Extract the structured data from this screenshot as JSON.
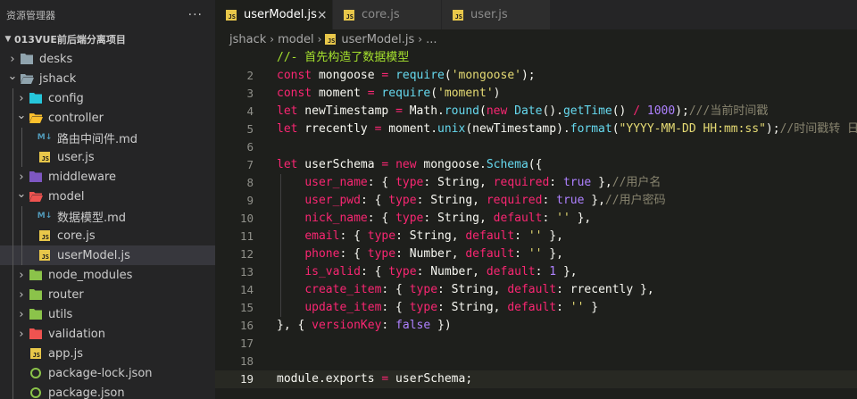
{
  "sidebar": {
    "title": "资源管理器",
    "more_glyph": "···",
    "section_title": "013VUE前后端分离项目",
    "tree": [
      {
        "label": "desks",
        "type": "folder",
        "open": false,
        "depth": 0,
        "icon_color": "#90a4ae"
      },
      {
        "label": "jshack",
        "type": "folder",
        "open": true,
        "depth": 0,
        "icon_color": "#90a4ae"
      },
      {
        "label": "config",
        "type": "folder",
        "open": false,
        "depth": 1,
        "icon_color": "#26c6da"
      },
      {
        "label": "controller",
        "type": "folder",
        "open": true,
        "depth": 1,
        "icon_color": "#fbc02d"
      },
      {
        "label": "路由中间件.md",
        "type": "md",
        "depth": 2
      },
      {
        "label": "user.js",
        "type": "js",
        "depth": 2
      },
      {
        "label": "middleware",
        "type": "folder",
        "open": false,
        "depth": 1,
        "icon_color": "#7e57c2"
      },
      {
        "label": "model",
        "type": "folder",
        "open": true,
        "depth": 1,
        "icon_color": "#ef5350"
      },
      {
        "label": "数据模型.md",
        "type": "md",
        "depth": 2
      },
      {
        "label": "core.js",
        "type": "js",
        "depth": 2
      },
      {
        "label": "userModel.js",
        "type": "js",
        "depth": 2,
        "selected": true
      },
      {
        "label": "node_modules",
        "type": "folder",
        "open": false,
        "depth": 1,
        "icon_color": "#8bc34a"
      },
      {
        "label": "router",
        "type": "folder",
        "open": false,
        "depth": 1,
        "icon_color": "#8bc34a"
      },
      {
        "label": "utils",
        "type": "folder",
        "open": false,
        "depth": 1,
        "icon_color": "#8bc34a"
      },
      {
        "label": "validation",
        "type": "folder",
        "open": false,
        "depth": 1,
        "icon_color": "#ef5350"
      },
      {
        "label": "app.js",
        "type": "js",
        "depth": 1
      },
      {
        "label": "package-lock.json",
        "type": "json",
        "depth": 1
      },
      {
        "label": "package.json",
        "type": "json",
        "depth": 1
      }
    ]
  },
  "tabs": [
    {
      "label": "userModel.js",
      "active": true,
      "close": "×"
    },
    {
      "label": "core.js",
      "active": false,
      "close": ""
    },
    {
      "label": "user.js",
      "active": false,
      "close": ""
    }
  ],
  "breadcrumb": {
    "parts": [
      "jshack",
      "model"
    ],
    "file": "userModel.js",
    "ellipsis": "..."
  },
  "editor": {
    "current_line": 19,
    "lines": [
      {
        "n": "",
        "tokens": [
          [
            "t-com",
            "//- 首先构造了数据模型"
          ]
        ]
      },
      {
        "n": "2",
        "tokens": [
          [
            "t-kw",
            "const"
          ],
          [
            "t-plain",
            " mongoose "
          ],
          [
            "t-kw",
            "="
          ],
          [
            "t-plain",
            " "
          ],
          [
            "t-fn",
            "require"
          ],
          [
            "t-plain",
            "("
          ],
          [
            "t-str",
            "'mongoose'"
          ],
          [
            "t-plain",
            ");"
          ]
        ]
      },
      {
        "n": "3",
        "tokens": [
          [
            "t-kw",
            "const"
          ],
          [
            "t-plain",
            " moment "
          ],
          [
            "t-kw",
            "="
          ],
          [
            "t-plain",
            " "
          ],
          [
            "t-fn",
            "require"
          ],
          [
            "t-plain",
            "("
          ],
          [
            "t-str",
            "'moment'"
          ],
          [
            "t-plain",
            ")"
          ]
        ]
      },
      {
        "n": "4",
        "tokens": [
          [
            "t-kw",
            "let"
          ],
          [
            "t-plain",
            " newTimestamp "
          ],
          [
            "t-kw",
            "="
          ],
          [
            "t-plain",
            " Math."
          ],
          [
            "t-fn",
            "round"
          ],
          [
            "t-plain",
            "("
          ],
          [
            "t-kw",
            "new"
          ],
          [
            "t-plain",
            " "
          ],
          [
            "t-fn",
            "Date"
          ],
          [
            "t-plain",
            "()."
          ],
          [
            "t-fn",
            "getTime"
          ],
          [
            "t-plain",
            "() "
          ],
          [
            "t-kw",
            "/"
          ],
          [
            "t-plain",
            " "
          ],
          [
            "t-num",
            "1000"
          ],
          [
            "t-plain",
            ");"
          ],
          [
            "t-gcom",
            "///当前时间戳"
          ]
        ]
      },
      {
        "n": "5",
        "tokens": [
          [
            "t-kw",
            "let"
          ],
          [
            "t-plain",
            " rrecently "
          ],
          [
            "t-kw",
            "="
          ],
          [
            "t-plain",
            " moment."
          ],
          [
            "t-fn",
            "unix"
          ],
          [
            "t-plain",
            "(newTimestamp)."
          ],
          [
            "t-fn",
            "format"
          ],
          [
            "t-plain",
            "("
          ],
          [
            "t-str",
            "\"YYYY-MM-DD HH:mm:ss\""
          ],
          [
            "t-plain",
            ");"
          ],
          [
            "t-gcom",
            "//时间戳转 日"
          ]
        ]
      },
      {
        "n": "6",
        "tokens": []
      },
      {
        "n": "7",
        "tokens": [
          [
            "t-kw",
            "let"
          ],
          [
            "t-plain",
            " userSchema "
          ],
          [
            "t-kw",
            "="
          ],
          [
            "t-plain",
            " "
          ],
          [
            "t-kw",
            "new"
          ],
          [
            "t-plain",
            " mongoose."
          ],
          [
            "t-fn",
            "Schema"
          ],
          [
            "t-plain",
            "({"
          ]
        ]
      },
      {
        "n": "8",
        "tokens": [
          [
            "t-plain",
            "    "
          ],
          [
            "t-kw",
            "user_name"
          ],
          [
            "t-plain",
            ": { "
          ],
          [
            "t-kw",
            "type"
          ],
          [
            "t-plain",
            ": String, "
          ],
          [
            "t-kw",
            "required"
          ],
          [
            "t-plain",
            ": "
          ],
          [
            "t-bool",
            "true"
          ],
          [
            "t-plain",
            " },"
          ],
          [
            "t-gcom",
            "//用户名"
          ]
        ]
      },
      {
        "n": "9",
        "tokens": [
          [
            "t-plain",
            "    "
          ],
          [
            "t-kw",
            "user_pwd"
          ],
          [
            "t-plain",
            ": { "
          ],
          [
            "t-kw",
            "type"
          ],
          [
            "t-plain",
            ": String, "
          ],
          [
            "t-kw",
            "required"
          ],
          [
            "t-plain",
            ": "
          ],
          [
            "t-bool",
            "true"
          ],
          [
            "t-plain",
            " },"
          ],
          [
            "t-gcom",
            "//用户密码"
          ]
        ]
      },
      {
        "n": "10",
        "tokens": [
          [
            "t-plain",
            "    "
          ],
          [
            "t-kw",
            "nick_name"
          ],
          [
            "t-plain",
            ": { "
          ],
          [
            "t-kw",
            "type"
          ],
          [
            "t-plain",
            ": String, "
          ],
          [
            "t-kw",
            "default"
          ],
          [
            "t-plain",
            ": "
          ],
          [
            "t-str",
            "''"
          ],
          [
            "t-plain",
            " },"
          ]
        ]
      },
      {
        "n": "11",
        "tokens": [
          [
            "t-plain",
            "    "
          ],
          [
            "t-kw",
            "email"
          ],
          [
            "t-plain",
            ": { "
          ],
          [
            "t-kw",
            "type"
          ],
          [
            "t-plain",
            ": String, "
          ],
          [
            "t-kw",
            "default"
          ],
          [
            "t-plain",
            ": "
          ],
          [
            "t-str",
            "''"
          ],
          [
            "t-plain",
            " },"
          ]
        ]
      },
      {
        "n": "12",
        "tokens": [
          [
            "t-plain",
            "    "
          ],
          [
            "t-kw",
            "phone"
          ],
          [
            "t-plain",
            ": { "
          ],
          [
            "t-kw",
            "type"
          ],
          [
            "t-plain",
            ": Number, "
          ],
          [
            "t-kw",
            "default"
          ],
          [
            "t-plain",
            ": "
          ],
          [
            "t-str",
            "''"
          ],
          [
            "t-plain",
            " },"
          ]
        ]
      },
      {
        "n": "13",
        "tokens": [
          [
            "t-plain",
            "    "
          ],
          [
            "t-kw",
            "is_valid"
          ],
          [
            "t-plain",
            ": { "
          ],
          [
            "t-kw",
            "type"
          ],
          [
            "t-plain",
            ": Number, "
          ],
          [
            "t-kw",
            "default"
          ],
          [
            "t-plain",
            ": "
          ],
          [
            "t-num",
            "1"
          ],
          [
            "t-plain",
            " },"
          ]
        ]
      },
      {
        "n": "14",
        "tokens": [
          [
            "t-plain",
            "    "
          ],
          [
            "t-kw",
            "create_item"
          ],
          [
            "t-plain",
            ": { "
          ],
          [
            "t-kw",
            "type"
          ],
          [
            "t-plain",
            ": String, "
          ],
          [
            "t-kw",
            "default"
          ],
          [
            "t-plain",
            ": rrecently },"
          ]
        ]
      },
      {
        "n": "15",
        "tokens": [
          [
            "t-plain",
            "    "
          ],
          [
            "t-kw",
            "update_item"
          ],
          [
            "t-plain",
            ": { "
          ],
          [
            "t-kw",
            "type"
          ],
          [
            "t-plain",
            ": String, "
          ],
          [
            "t-kw",
            "default"
          ],
          [
            "t-plain",
            ": "
          ],
          [
            "t-str",
            "''"
          ],
          [
            "t-plain",
            " }"
          ]
        ]
      },
      {
        "n": "16",
        "tokens": [
          [
            "t-plain",
            "}, { "
          ],
          [
            "t-kw",
            "versionKey"
          ],
          [
            "t-plain",
            ": "
          ],
          [
            "t-bool",
            "false"
          ],
          [
            "t-plain",
            " })"
          ]
        ]
      },
      {
        "n": "17",
        "tokens": []
      },
      {
        "n": "18",
        "tokens": []
      },
      {
        "n": "19",
        "tokens": [
          [
            "t-plain",
            "module.exports "
          ],
          [
            "t-kw",
            "="
          ],
          [
            "t-plain",
            " userSchema;"
          ]
        ]
      }
    ]
  },
  "colors": {
    "js_icon": "#e8c74a",
    "md_icon": "#519aba",
    "json_icon": "#8bc34a",
    "selection": "#37373d"
  }
}
